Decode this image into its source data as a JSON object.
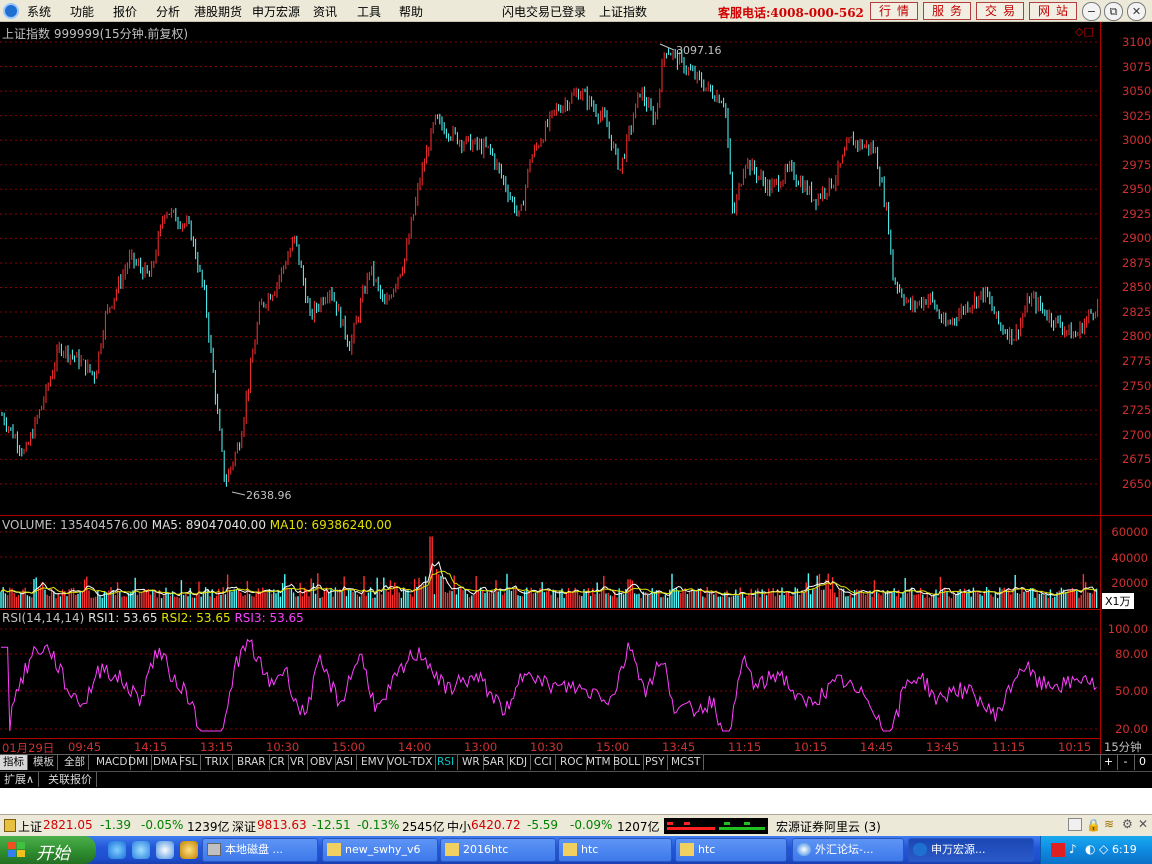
{
  "menubar": {
    "items": [
      "系统",
      "功能",
      "报价",
      "分析",
      "港股期货",
      "申万宏源",
      "资讯",
      "工具",
      "帮助"
    ],
    "status": "闪电交易已登录",
    "index_name": "上证指数",
    "hotline": "客服电话:4008-000-562",
    "nav_buttons": [
      "行情",
      "服务",
      "交易",
      "网站"
    ],
    "window_buttons": [
      "−",
      "⧉",
      "✕"
    ]
  },
  "chart": {
    "title": "上证指数 999999(15分钟.前复权)",
    "high_label": "3097.16",
    "low_label": "2638.96",
    "y_ticks": [
      "3100",
      "3075",
      "3050",
      "3025",
      "3000",
      "2975",
      "2950",
      "2925",
      "2900",
      "2875",
      "2850",
      "2825",
      "2800",
      "2775",
      "2750",
      "2725",
      "2700",
      "2675",
      "2650"
    ],
    "colors": {
      "up": "#ff3030",
      "down": "#54ffff",
      "grid": "#8b0000",
      "ma5": "#ffffff",
      "ma10": "#e0e000",
      "rsi": "#ff40ff"
    }
  },
  "volume": {
    "label": "VOLUME: 135404576.00",
    "ma5": "MA5: 89047040.00",
    "ma10": "MA10: 69386240.00",
    "y_ticks": [
      "60000",
      "40000",
      "20000"
    ],
    "unit": "X1万"
  },
  "rsi": {
    "label": "RSI(14,14,14)",
    "rsi1": "RSI1: 53.65",
    "rsi2": "RSI2: 53.65",
    "rsi3": "RSI3: 53.65",
    "y_ticks": [
      "100.00",
      "80.00",
      "50.00",
      "20.00"
    ]
  },
  "time_axis": {
    "labels": [
      "01月29日",
      "09:45",
      "14:15",
      "13:15",
      "10:30",
      "15:00",
      "14:00",
      "13:00",
      "10:30",
      "15:00",
      "13:45",
      "11:15",
      "10:15",
      "14:45",
      "13:45",
      "11:15",
      "10:15"
    ],
    "period": "15分钟"
  },
  "indicators": {
    "tabs": [
      "指标",
      "模板",
      "全部",
      "MACD",
      "DMI",
      "DMA",
      "FSL",
      "TRIX",
      "BRAR",
      "CR",
      "VR",
      "OBV",
      "ASI",
      "EMV",
      "VOL-TDX",
      "RSI",
      "WR",
      "SAR",
      "KDJ",
      "CCI",
      "ROC",
      "MTM",
      "BOLL",
      "PSY",
      "MCST"
    ],
    "active": "RSI",
    "controls": [
      "+",
      "-",
      "0"
    ]
  },
  "subtabs": [
    "扩展∧",
    "关联报价"
  ],
  "statusbar": {
    "sh_name": "上证",
    "sh_value": "2821.05",
    "sh_change": "-1.39",
    "sh_pct": "-0.05%",
    "sh_amount": "1239亿",
    "sz_name": "深证",
    "sz_value": "9813.63",
    "sz_change": "-12.51",
    "sz_pct": "-0.13%",
    "sz_amount": "2545亿",
    "zx_name": "中小",
    "zx_value": "6420.72",
    "zx_change": "-5.59",
    "zx_pct": "-0.09%",
    "zx_amount": "1207亿",
    "server": "宏源证券阿里云 (3)"
  },
  "taskbar": {
    "start": "开始",
    "tasks": [
      "本地磁盘 ...",
      "new_swhy_v6",
      "2016htc",
      "htc",
      "htc",
      "外汇论坛-...",
      "申万宏源..."
    ],
    "clock": "6:19"
  }
}
